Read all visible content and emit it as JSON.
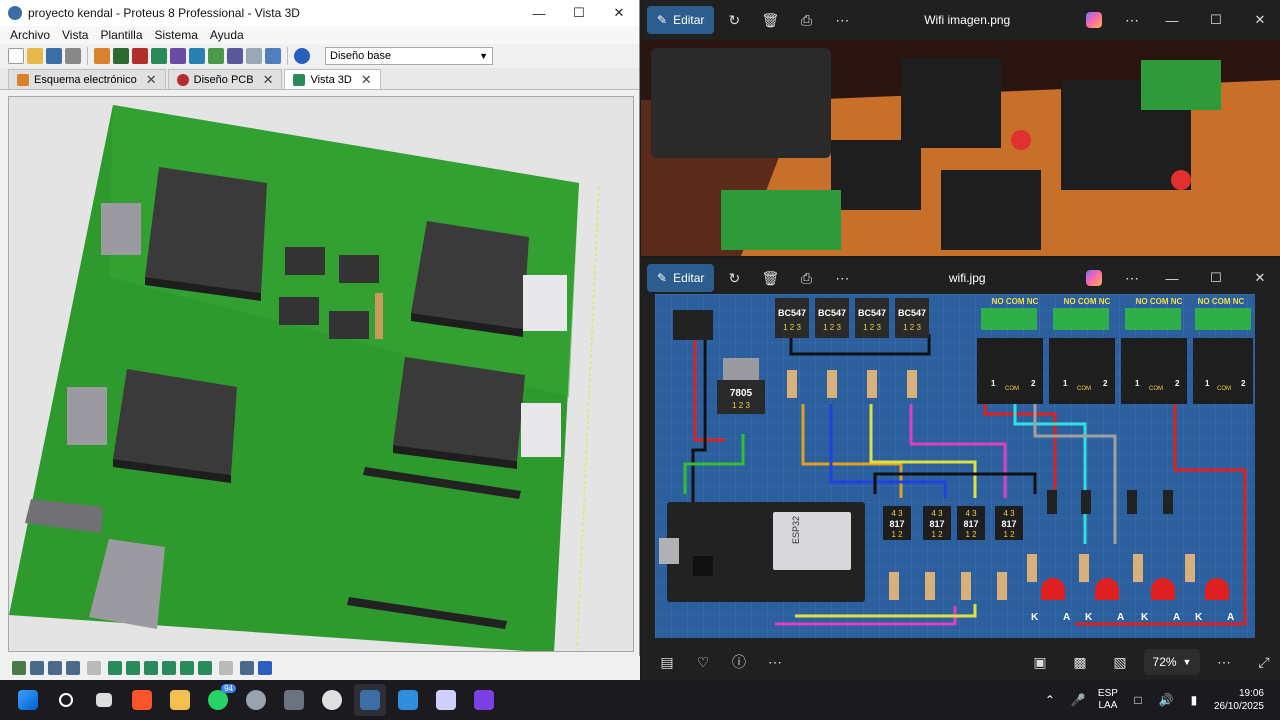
{
  "proteus": {
    "title": "proyecto kendal - Proteus 8 Professional - Vista 3D",
    "menu": [
      "Archivo",
      "Vista",
      "Plantilla",
      "Sistema",
      "Ayuda"
    ],
    "combo_value": "Diseño base",
    "tabs": [
      {
        "label": "Esquema electrónico",
        "icon": "schematic-icon"
      },
      {
        "label": "Diseño PCB",
        "icon": "pcb-icon"
      },
      {
        "label": "Vista 3D",
        "icon": "view-3d-icon",
        "active": true
      }
    ]
  },
  "photos_top": {
    "title": "Wifi imagen.png",
    "edit_label": "Editar"
  },
  "photos_bottom": {
    "title": "wifi.jpg",
    "edit_label": "Editar",
    "zoom": "72%",
    "circuit": {
      "transistors": [
        "BC547",
        "BC547",
        "BC547",
        "BC547"
      ],
      "transistor_pins": "1 2 3",
      "regulator": "7805",
      "relay_labels": [
        "NO COM NC",
        "NO COM NC",
        "NO COM NC",
        "NO COM NC"
      ],
      "relay_pins": {
        "left": "1",
        "com": "COM",
        "right": "2",
        "no": "NO",
        "nc": "NC"
      },
      "optocouplers": [
        "817",
        "817",
        "817",
        "817"
      ],
      "opto_pins_top": "4 3",
      "opto_pins_bottom": "1 2",
      "mcu": "ESP32",
      "led_pins": [
        "K",
        "A",
        "K",
        "A",
        "K",
        "A",
        "K",
        "A"
      ]
    }
  },
  "taskbar": {
    "whatsapp_badge": "94",
    "lang_top": "ESP",
    "lang_bottom": "LAA",
    "time": "19:06",
    "date": "26/10/2025"
  },
  "colors": {
    "pcb_green": "#2e9a2e",
    "edit_button": "#2b5e8f",
    "breadboard_blue": "#2c5f9e"
  }
}
